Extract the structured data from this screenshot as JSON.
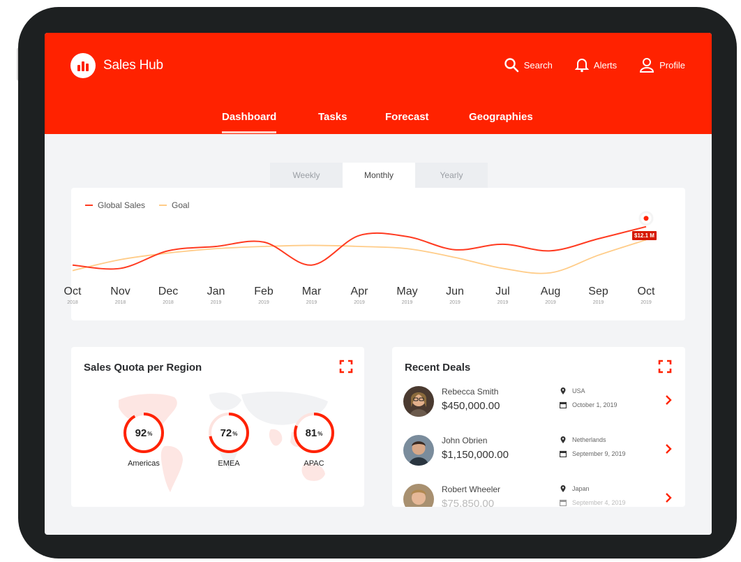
{
  "app": {
    "name": "Sales Hub",
    "brand_color": "#ff2200"
  },
  "header": {
    "actions": [
      {
        "label": "Search",
        "icon": "search-icon"
      },
      {
        "label": "Alerts",
        "icon": "bell-icon"
      },
      {
        "label": "Profile",
        "icon": "user-icon"
      }
    ]
  },
  "nav": {
    "items": [
      {
        "label": "Dashboard",
        "active": true
      },
      {
        "label": "Tasks",
        "active": false
      },
      {
        "label": "Forecast",
        "active": false
      },
      {
        "label": "Geographies",
        "active": false
      }
    ]
  },
  "period_tabs": {
    "items": [
      "Weekly",
      "Monthly",
      "Yearly"
    ],
    "selected": "Monthly"
  },
  "chart_data": {
    "type": "line",
    "title": "",
    "x": [
      "Oct 2018",
      "Nov 2018",
      "Dec 2018",
      "Jan 2019",
      "Feb 2019",
      "Mar 2019",
      "Apr 2019",
      "May 2019",
      "Jun 2019",
      "Jul 2019",
      "Aug 2019",
      "Sep 2019",
      "Oct 2019"
    ],
    "months": [
      {
        "name": "Oct",
        "year": "2018"
      },
      {
        "name": "Nov",
        "year": "2018"
      },
      {
        "name": "Dec",
        "year": "2018"
      },
      {
        "name": "Jan",
        "year": "2019"
      },
      {
        "name": "Feb",
        "year": "2019"
      },
      {
        "name": "Mar",
        "year": "2019"
      },
      {
        "name": "Apr",
        "year": "2019"
      },
      {
        "name": "May",
        "year": "2019"
      },
      {
        "name": "Jun",
        "year": "2019"
      },
      {
        "name": "Jul",
        "year": "2019"
      },
      {
        "name": "Aug",
        "year": "2019"
      },
      {
        "name": "Sep",
        "year": "2019"
      },
      {
        "name": "Oct",
        "year": "2019"
      }
    ],
    "series": [
      {
        "name": "Global Sales",
        "color": "#ff3b21",
        "values": [
          45,
          42,
          58,
          62,
          66,
          45,
          72,
          71,
          59,
          64,
          58,
          69,
          80
        ]
      },
      {
        "name": "Goal",
        "color": "#ffcc88",
        "values": [
          40,
          50,
          56,
          60,
          62,
          63,
          62,
          60,
          52,
          42,
          38,
          54,
          68
        ]
      }
    ],
    "highlight_label": "$12.1 M",
    "ylim": [
      20,
      90
    ],
    "grid": false,
    "legend_position": "top-left"
  },
  "quota": {
    "title": "Sales Quota per Region",
    "regions": [
      {
        "name": "Americas",
        "value": 92,
        "unit": "%"
      },
      {
        "name": "EMEA",
        "value": 72,
        "unit": "%"
      },
      {
        "name": "APAC",
        "value": 81,
        "unit": "%"
      }
    ]
  },
  "deals": {
    "title": "Recent Deals",
    "items": [
      {
        "name": "Rebecca Smith",
        "amount": "$450,000.00",
        "country": "USA",
        "date": "October 1, 2019"
      },
      {
        "name": "John Obrien",
        "amount": "$1,150,000.00",
        "country": "Netherlands",
        "date": "September 9, 2019"
      },
      {
        "name": "Robert Wheeler",
        "amount": "$75,850.00",
        "country": "Japan",
        "date": "September 4, 2019"
      }
    ]
  }
}
